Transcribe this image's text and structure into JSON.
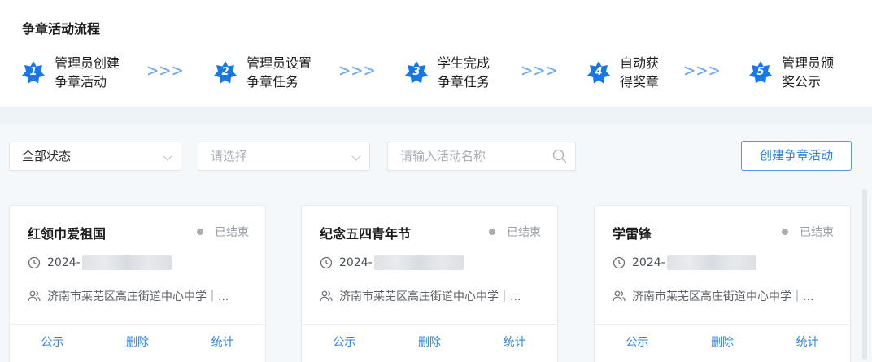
{
  "flow": {
    "title": "争章活动流程",
    "steps": [
      {
        "num": "1",
        "line1": "管理员创建",
        "line2": "争章活动"
      },
      {
        "num": "2",
        "line1": "管理员设置",
        "line2": "争章任务"
      },
      {
        "num": "3",
        "line1": "学生完成",
        "line2": "争章任务"
      },
      {
        "num": "4",
        "line1": "自动获",
        "line2": "得奖章"
      },
      {
        "num": "5",
        "line1": "管理员颁",
        "line2": "奖公示"
      }
    ],
    "arrow": ">>>"
  },
  "filters": {
    "status_select": "全部状态",
    "type_select_placeholder": "请选择",
    "search_placeholder": "请输入活动名称"
  },
  "toolbar": {
    "create_label": "创建争章活动"
  },
  "cards": [
    {
      "title": "红领巾爱祖国",
      "status": "已结束",
      "date": "2024-",
      "org": "济南市莱芜区高庄街道中心中学｜...",
      "actions": [
        "公示",
        "删除",
        "统计"
      ]
    },
    {
      "title": "纪念五四青年节",
      "status": "已结束",
      "date": "2024-",
      "org": "济南市莱芜区高庄街道中心中学｜...",
      "actions": [
        "公示",
        "删除",
        "统计"
      ]
    },
    {
      "title": "学雷锋",
      "status": "已结束",
      "date": "2024-",
      "org": "济南市莱芜区高庄街道中心中学｜...",
      "actions": [
        "公示",
        "删除",
        "统计"
      ]
    }
  ],
  "icons": {
    "step": "star-badge-icon",
    "clock": "clock-icon",
    "users": "users-icon",
    "search": "search-icon",
    "dropdown": "chevron-down-icon"
  },
  "colors": {
    "accent": "#2c83e0",
    "step_badge": "#1677e8",
    "arrow": "#6aa6f2",
    "status_dot": "#a9aeb4"
  }
}
